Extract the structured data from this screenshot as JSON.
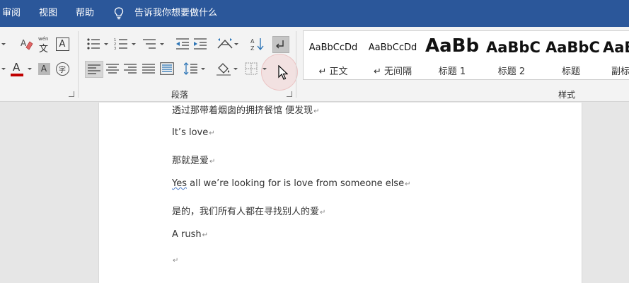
{
  "ribbon_tabs": [
    {
      "label": "审阅"
    },
    {
      "label": "视图"
    },
    {
      "label": "帮助"
    }
  ],
  "tell_me": {
    "label": "告诉我你想要做什么"
  },
  "groups": {
    "paragraph": {
      "label": "段落"
    },
    "styles": {
      "label": "样式"
    }
  },
  "font_group": {
    "phonetic_glyph": "文",
    "phonetic_small": "wén",
    "char_border_glyph": "A",
    "font_color_glyph": "A",
    "shading_glyph": "A",
    "enclose_glyph": "字",
    "font_color": "#c00000"
  },
  "styles_gallery": [
    {
      "sample": "AaBbCcDd",
      "name": "↵ 正文"
    },
    {
      "sample": "AaBbCcDd",
      "name": "↵ 无间隔"
    },
    {
      "sample": "AaBb",
      "name": "标题 1"
    },
    {
      "sample": "AaBbC",
      "name": "标题 2"
    },
    {
      "sample": "AaBbC",
      "name": "标题"
    },
    {
      "sample": "AaBb",
      "name": "副标"
    }
  ],
  "document": {
    "lines": [
      {
        "text": "透过那带着烟囱的拥挤餐馆  便发现"
      },
      {
        "text": "It’s love"
      },
      {
        "text": "那就是爱"
      },
      {
        "text_first": "Yes",
        "text_rest": " all we’re looking for is love from someone else"
      },
      {
        "text": "是的，我们所有人都在寻找别人的爱"
      },
      {
        "text": "A rush"
      },
      {
        "text": ""
      }
    ],
    "paragraph_mark": "↵"
  },
  "colors": {
    "ribbon_blue": "#2b579a",
    "ribbon_bg": "#f3f3f3",
    "font_color_red": "#c00000",
    "highlight_ring": "#f0aaaa"
  }
}
